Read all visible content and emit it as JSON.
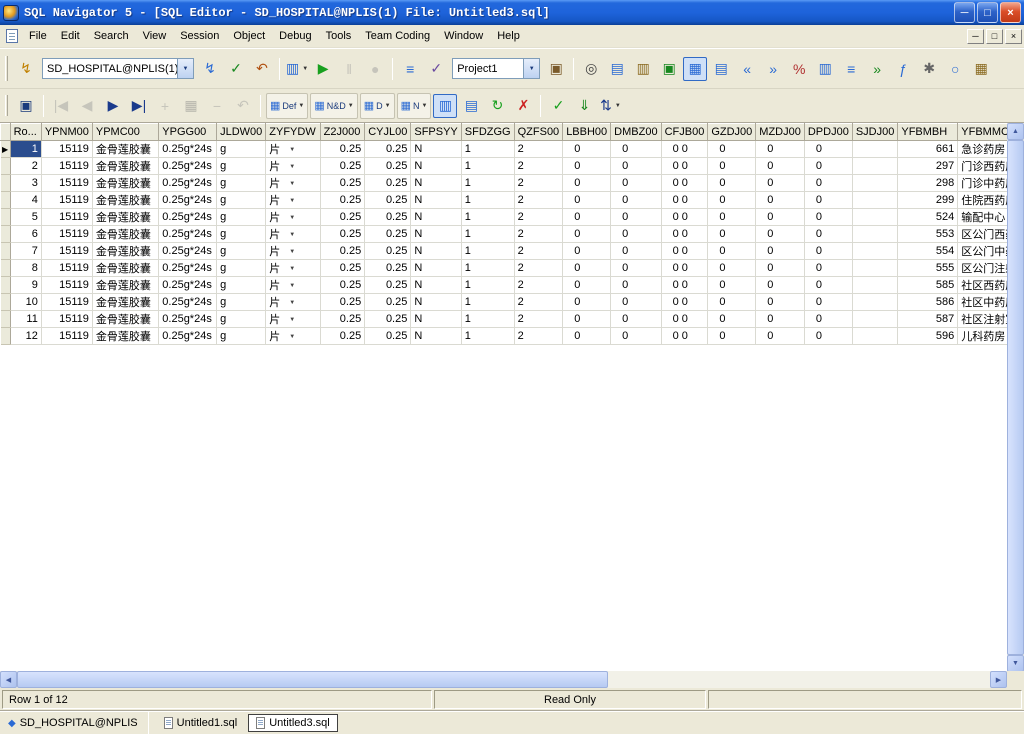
{
  "colors": {
    "titlebar": "#1E63DB",
    "selection": "#2B4D8E",
    "toolbar_face": "#ECE9D8",
    "pressed_highlight": "#CFE0F7"
  },
  "icons": {
    "up": "▲",
    "down": "▼",
    "left": "◀",
    "right": "▶",
    "dropdown": "▼"
  },
  "window": {
    "title": "SQL Navigator 5 - [SQL Editor - SD_HOSPITAL@NPLIS(1) File: Untitled3.sql]",
    "controls": {
      "minimize": "─",
      "restore": "□",
      "close": "×"
    }
  },
  "menu": {
    "items": [
      "File",
      "Edit",
      "Search",
      "View",
      "Session",
      "Object",
      "Debug",
      "Tools",
      "Team Coding",
      "Window",
      "Help"
    ]
  },
  "toolbar_main": {
    "items": [
      {
        "type": "icon",
        "name": "new-session-icon",
        "glyph": "↯",
        "color": "#C08000"
      },
      {
        "type": "combo",
        "name": "session-combo",
        "value": "SD_HOSPITAL@NPLIS(1)",
        "width": 152
      },
      {
        "type": "icon",
        "name": "connect-icon",
        "glyph": "↯",
        "color": "#2A6AD4"
      },
      {
        "type": "icon",
        "name": "commit-icon",
        "glyph": "✓",
        "color": "#18881F"
      },
      {
        "type": "icon",
        "name": "rollback-icon",
        "glyph": "↶",
        "color": "#B05010"
      },
      {
        "type": "sep"
      },
      {
        "type": "split",
        "name": "new-editor-icon",
        "glyph": "▥",
        "color": "#2A6AD4"
      },
      {
        "type": "icon",
        "name": "execute-icon",
        "glyph": "▶",
        "color": "#18A01E"
      },
      {
        "type": "icon",
        "name": "pause-icon",
        "glyph": "‖",
        "color": "#999999",
        "disabled": true
      },
      {
        "type": "icon",
        "name": "halt-icon",
        "glyph": "●",
        "color": "#999999",
        "disabled": true
      },
      {
        "type": "sep"
      },
      {
        "type": "icon",
        "name": "explain-plan-icon",
        "glyph": "≡",
        "color": "#2A6AD4"
      },
      {
        "type": "icon",
        "name": "code-analysis-icon",
        "glyph": "✓",
        "color": "#6A4AA0"
      },
      {
        "type": "combo",
        "name": "project-combo",
        "value": "Project1",
        "width": 88
      },
      {
        "type": "icon",
        "name": "project-manager-icon",
        "glyph": "▣",
        "color": "#7A5A2A"
      },
      {
        "type": "sep"
      },
      {
        "type": "icon",
        "name": "find-objects-icon",
        "glyph": "◎",
        "color": "#444444"
      },
      {
        "type": "icon",
        "name": "describe-object-icon",
        "glyph": "▤",
        "color": "#2A6AD4"
      },
      {
        "type": "icon",
        "name": "extract-ddl-icon",
        "glyph": "▥",
        "color": "#8A6A20"
      },
      {
        "type": "icon",
        "name": "code-test-icon",
        "glyph": "▣",
        "color": "#18881F"
      },
      {
        "type": "icon",
        "name": "output-grid-icon",
        "glyph": "▦",
        "color": "#2A6AD4",
        "pressed": true
      },
      {
        "type": "icon",
        "name": "table-view-icon",
        "glyph": "▤",
        "color": "#2A6AD4"
      },
      {
        "type": "icon",
        "name": "import-data-icon",
        "glyph": "«",
        "color": "#2A6AD4"
      },
      {
        "type": "icon",
        "name": "export-data-icon",
        "glyph": "»",
        "color": "#2A6AD4"
      },
      {
        "type": "icon",
        "name": "filter-rows-icon",
        "glyph": "%",
        "color": "#B03030"
      },
      {
        "type": "icon",
        "name": "column-layout-icon",
        "glyph": "▥",
        "color": "#2A6AD4"
      },
      {
        "type": "icon",
        "name": "row-list-icon",
        "glyph": "≡",
        "color": "#2A6AD4"
      },
      {
        "type": "icon",
        "name": "continue-fetch-icon",
        "glyph": "»",
        "color": "#18881F"
      },
      {
        "type": "icon",
        "name": "function-wizard-icon",
        "glyph": "ƒ",
        "color": "#2A6AD4"
      },
      {
        "type": "icon",
        "name": "preferences-icon",
        "glyph": "✱",
        "color": "#666666"
      },
      {
        "type": "icon",
        "name": "session-monitor-icon",
        "glyph": "○",
        "color": "#2A6AD4"
      },
      {
        "type": "icon",
        "name": "new-grid-icon",
        "glyph": "▦",
        "color": "#8A6A20"
      }
    ]
  },
  "toolbar_grid": {
    "items": [
      {
        "type": "icon",
        "name": "save-grid-icon",
        "glyph": "▣",
        "color": "#1A3A7C"
      },
      {
        "type": "sep"
      },
      {
        "type": "icon",
        "name": "first-record-icon",
        "glyph": "|◀",
        "color": "#9A9A9A",
        "disabled": true
      },
      {
        "type": "icon",
        "name": "prior-record-icon",
        "glyph": "◀",
        "color": "#9A9A9A",
        "disabled": true
      },
      {
        "type": "icon",
        "name": "next-record-icon",
        "glyph": "▶",
        "color": "#1A3A8C"
      },
      {
        "type": "icon",
        "name": "last-record-icon",
        "glyph": "▶|",
        "color": "#1A3A8C"
      },
      {
        "type": "icon",
        "name": "insert-record-icon",
        "glyph": "+",
        "color": "#9A9A9A",
        "disabled": true
      },
      {
        "type": "icon",
        "name": "edit-record-icon",
        "glyph": "▦",
        "color": "#777777",
        "disabled": true
      },
      {
        "type": "icon",
        "name": "delete-record-icon",
        "glyph": "−",
        "color": "#9A9A9A",
        "disabled": true
      },
      {
        "type": "icon",
        "name": "revert-record-icon",
        "glyph": "↶",
        "color": "#9A9A9A",
        "disabled": true
      },
      {
        "type": "sep"
      },
      {
        "type": "fetch",
        "name": "fetch-default-button",
        "caption": "Def"
      },
      {
        "type": "fetch",
        "name": "fetch-names-descriptions-button",
        "caption": "N&D"
      },
      {
        "type": "fetch",
        "name": "fetch-descriptions-button",
        "caption": "D"
      },
      {
        "type": "fetch",
        "name": "fetch-names-button",
        "caption": "N"
      },
      {
        "type": "icon",
        "name": "grid-view-icon",
        "glyph": "▥",
        "color": "#2A6AD4",
        "pressed": true
      },
      {
        "type": "icon",
        "name": "record-view-icon",
        "glyph": "▤",
        "color": "#2A6AD4"
      },
      {
        "type": "icon",
        "name": "refresh-query-icon",
        "glyph": "↻",
        "color": "#18A01E"
      },
      {
        "type": "icon",
        "name": "cancel-query-icon",
        "glyph": "✗",
        "color": "#CC2020"
      },
      {
        "type": "sep"
      },
      {
        "type": "icon",
        "name": "commit-edit-icon",
        "glyph": "✓",
        "color": "#18A01E"
      },
      {
        "type": "icon",
        "name": "fetch-all-rows-icon",
        "glyph": "⇓",
        "color": "#18881F"
      },
      {
        "type": "split",
        "name": "sort-options-icon",
        "glyph": "⇅",
        "color": "#1A3A8C"
      }
    ]
  },
  "grid": {
    "selected_row_indicator": "▶",
    "columns": [
      "Ro...",
      "YPNM00",
      "YPMC00",
      "YPGG00",
      "JLDW00",
      "ZYFYDW",
      "Z2J000",
      "CYJL00",
      "SFPSYY",
      "SFDZGG",
      "QZFS00",
      "LBBH00",
      "DMBZ00",
      "CFJB00",
      "GZDJ00",
      "MZDJ00",
      "DPDJ00",
      "SJDJ00",
      "YFBMBH",
      "YFBMMC"
    ],
    "rows": [
      [
        "1",
        "15119",
        "金骨莲胶囊",
        "0.25g*24s",
        "g",
        "片",
        "0.25",
        "0.25",
        "N",
        "1",
        "2",
        "0",
        "0",
        "0 0",
        "0",
        "0",
        "0",
        "",
        "661",
        "急诊药房"
      ],
      [
        "2",
        "15119",
        "金骨莲胶囊",
        "0.25g*24s",
        "g",
        "片",
        "0.25",
        "0.25",
        "N",
        "1",
        "2",
        "0",
        "0",
        "0 0",
        "0",
        "0",
        "0",
        "",
        "297",
        "门诊西药房"
      ],
      [
        "3",
        "15119",
        "金骨莲胶囊",
        "0.25g*24s",
        "g",
        "片",
        "0.25",
        "0.25",
        "N",
        "1",
        "2",
        "0",
        "0",
        "0 0",
        "0",
        "0",
        "0",
        "",
        "298",
        "门诊中药房"
      ],
      [
        "4",
        "15119",
        "金骨莲胶囊",
        "0.25g*24s",
        "g",
        "片",
        "0.25",
        "0.25",
        "N",
        "1",
        "2",
        "0",
        "0",
        "0 0",
        "0",
        "0",
        "0",
        "",
        "299",
        "住院西药房"
      ],
      [
        "5",
        "15119",
        "金骨莲胶囊",
        "0.25g*24s",
        "g",
        "片",
        "0.25",
        "0.25",
        "N",
        "1",
        "2",
        "0",
        "0",
        "0 0",
        "0",
        "0",
        "0",
        "",
        "524",
        "输配中心"
      ],
      [
        "6",
        "15119",
        "金骨莲胶囊",
        "0.25g*24s",
        "g",
        "片",
        "0.25",
        "0.25",
        "N",
        "1",
        "2",
        "0",
        "0",
        "0 0",
        "0",
        "0",
        "0",
        "",
        "553",
        "区公门西药"
      ],
      [
        "7",
        "15119",
        "金骨莲胶囊",
        "0.25g*24s",
        "g",
        "片",
        "0.25",
        "0.25",
        "N",
        "1",
        "2",
        "0",
        "0",
        "0 0",
        "0",
        "0",
        "0",
        "",
        "554",
        "区公门中药"
      ],
      [
        "8",
        "15119",
        "金骨莲胶囊",
        "0.25g*24s",
        "g",
        "片",
        "0.25",
        "0.25",
        "N",
        "1",
        "2",
        "0",
        "0",
        "0 0",
        "0",
        "0",
        "0",
        "",
        "555",
        "区公门注射"
      ],
      [
        "9",
        "15119",
        "金骨莲胶囊",
        "0.25g*24s",
        "g",
        "片",
        "0.25",
        "0.25",
        "N",
        "1",
        "2",
        "0",
        "0",
        "0 0",
        "0",
        "0",
        "0",
        "",
        "585",
        "社区西药房"
      ],
      [
        "10",
        "15119",
        "金骨莲胶囊",
        "0.25g*24s",
        "g",
        "片",
        "0.25",
        "0.25",
        "N",
        "1",
        "2",
        "0",
        "0",
        "0 0",
        "0",
        "0",
        "0",
        "",
        "586",
        "社区中药房"
      ],
      [
        "11",
        "15119",
        "金骨莲胶囊",
        "0.25g*24s",
        "g",
        "片",
        "0.25",
        "0.25",
        "N",
        "1",
        "2",
        "0",
        "0",
        "0 0",
        "0",
        "0",
        "0",
        "",
        "587",
        "社区注射室"
      ],
      [
        "12",
        "15119",
        "金骨莲胶囊",
        "0.25g*24s",
        "g",
        "片",
        "0.25",
        "0.25",
        "N",
        "1",
        "2",
        "0",
        "0",
        "0 0",
        "0",
        "0",
        "0",
        "",
        "596",
        "儿科药房"
      ]
    ]
  },
  "status": {
    "row_text": "Row 1 of 12",
    "mode_text": "Read Only"
  },
  "taskbar": {
    "session_label": "SD_HOSPITAL@NPLIS",
    "tabs": [
      {
        "label": "Untitled1.sql",
        "active": false
      },
      {
        "label": "Untitled3.sql",
        "active": true
      }
    ]
  }
}
